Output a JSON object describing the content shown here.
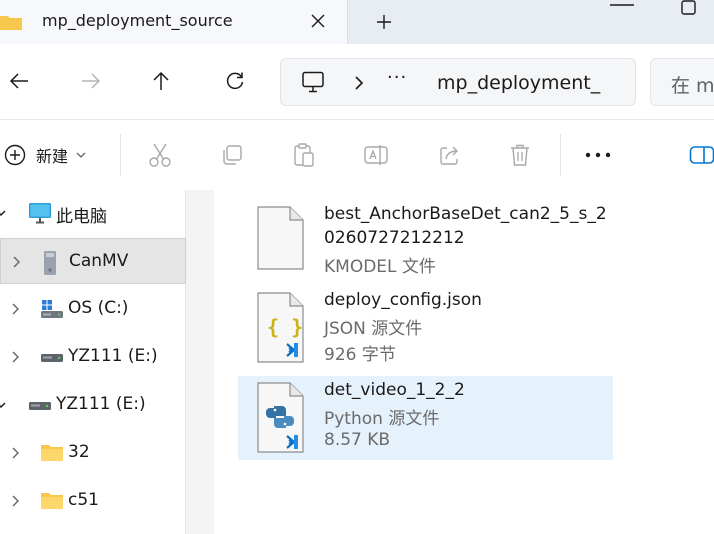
{
  "tab": {
    "title": "mp_deployment_source"
  },
  "address": {
    "crumb_more": "···",
    "location": "mp_deployment_"
  },
  "search": {
    "placeholder": "在 m"
  },
  "toolbar": {
    "new_label": "新建"
  },
  "sidebar": {
    "items": [
      {
        "label": "此电脑"
      },
      {
        "label": "CanMV"
      },
      {
        "label": "OS (C:)"
      },
      {
        "label": "YZ111 (E:)"
      },
      {
        "label": "YZ111 (E:)"
      },
      {
        "label": "32"
      },
      {
        "label": "c51"
      }
    ]
  },
  "files": [
    {
      "name_line1": "best_AnchorBaseDet_can2_5_s_2",
      "name_line2": "0260727212212",
      "type": "KMODEL 文件"
    },
    {
      "name": "deploy_config.json",
      "type": "JSON 源文件",
      "size": "926 字节"
    },
    {
      "name": "det_video_1_2_2",
      "type": "Python 源文件",
      "size": "8.57 KB"
    }
  ],
  "colors": {
    "accent": "#0078d4",
    "selection": "#e5f1fb",
    "folder": "#f8c84d",
    "python_blue": "#3572a5",
    "json_yellow": "#c9b318"
  }
}
